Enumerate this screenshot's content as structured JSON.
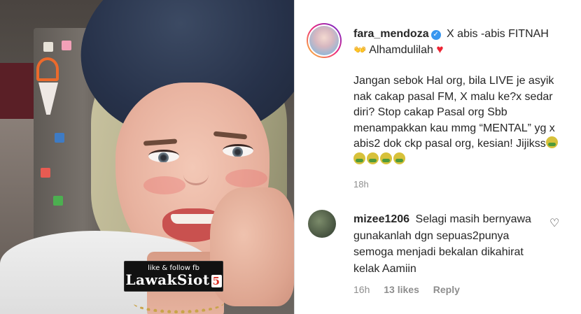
{
  "media": {
    "watermark_top": "like & follow fb",
    "watermark_logo": "LawakSiot",
    "watermark_num": "5"
  },
  "post": {
    "username": "fara_mendoza",
    "caption_line1": "X abis -abis FITNAH",
    "caption_line1b": "Alhamdulilah",
    "caption_body": "Jangan sebok Hal org, bila LIVE je asyik nak cakap pasal FM, X malu ke?x sedar diri? Stop cakap Pasal org Sbb menampakkan kau mmg “MENTAL” yg x abis2 dok ckp pasal org, kesian! Jijikss",
    "time": "18h",
    "icons": {
      "verified": "verified-badge-icon",
      "heart": "red-heart-icon",
      "hands": "raised-hands-icon",
      "sick": "nauseated-face-icon"
    },
    "sick_count": 5
  },
  "comment": {
    "username": "mizee1206",
    "text": "Selagi masih bernyawa gunakanlah dgn sepuas2punya semoga menjadi bekalan dikahirat kelak Aamiin",
    "time": "16h",
    "likes": "13 likes",
    "reply": "Reply"
  },
  "colors": {
    "verified": "#3897f0",
    "meta": "#8e8e8e",
    "heart": "#ed2433"
  }
}
